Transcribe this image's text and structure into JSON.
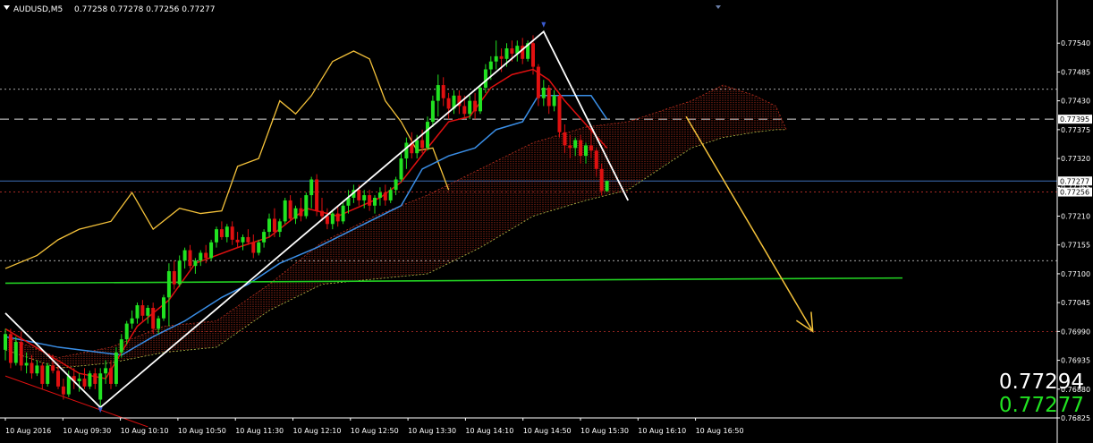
{
  "header": {
    "symbol_text": "AUDUSD,M5",
    "ohlc_text": "0.77258 0.77278 0.77256 0.77277"
  },
  "prices": {
    "bid": "0.77294",
    "ask": "0.77277"
  },
  "colors": {
    "background": "#000000",
    "bull": "#21e221",
    "bear": "#e01010",
    "tenkan": "#e01010",
    "kijun": "#3a8ee6",
    "chikou": "#f5c23a",
    "kumo": "#c0301f",
    "trendline": "#ffffff",
    "green_line": "#22d022",
    "forecast_arrow": "#f5c23a",
    "level_dotted": "#e0e0e0",
    "level_red_dotted": "#c0302a",
    "dashed_level": "#e0e0e0",
    "current_line": "#3d6fb8"
  },
  "chart_data": {
    "type": "candlestick",
    "symbol": "AUDUSD",
    "timeframe": "M5",
    "ylim": [
      0.76825,
      0.77595
    ],
    "yticks": [
      "0.77540",
      "0.77485",
      "0.77430",
      "0.77375",
      "0.77320",
      "0.77265",
      "0.77210",
      "0.77155",
      "0.77100",
      "0.77045",
      "0.76990",
      "0.76935",
      "0.76880",
      "0.76825"
    ],
    "xticks": [
      "10 Aug 2016",
      "10 Aug 09:30",
      "10 Aug 10:10",
      "10 Aug 10:50",
      "10 Aug 11:30",
      "10 Aug 12:10",
      "10 Aug 12:50",
      "10 Aug 13:30",
      "10 Aug 14:10",
      "10 Aug 14:50",
      "10 Aug 15:30",
      "10 Aug 16:10",
      "10 Aug 16:50"
    ],
    "price_tags": [
      {
        "value": 0.77395,
        "label": "0.77395"
      },
      {
        "value": 0.77277,
        "label": "0.77277"
      },
      {
        "value": 0.77256,
        "label": "0.77256"
      }
    ],
    "levels": {
      "dotted_white": [
        0.77452,
        0.77125
      ],
      "dotted_red": [
        0.77256,
        0.7699
      ],
      "dashed_white": 0.77395,
      "current": 0.77277
    },
    "green_line": [
      [
        0,
        0.77082
      ],
      [
        170,
        0.77092
      ]
    ],
    "trendlines": [
      {
        "points": [
          [
            0,
            0.77025
          ],
          [
            18,
            0.76845
          ],
          [
            102,
            0.77562
          ],
          [
            118,
            0.7724
          ]
        ]
      },
      {
        "points": [
          [
            0,
            0.76905
          ],
          [
            27,
            0.76808
          ]
        ]
      }
    ],
    "forecast_arrow": {
      "from": [
        129,
        0.774
      ],
      "to": [
        153,
        0.7699
      ]
    },
    "candles": [
      [
        0.76955,
        0.76995,
        0.76935,
        0.76985
      ],
      [
        0.76985,
        0.76995,
        0.7692,
        0.7693
      ],
      [
        0.7693,
        0.7698,
        0.76925,
        0.7697
      ],
      [
        0.7697,
        0.7699,
        0.76915,
        0.76925
      ],
      [
        0.76925,
        0.7695,
        0.7691,
        0.7693
      ],
      [
        0.7693,
        0.76945,
        0.769,
        0.7691
      ],
      [
        0.7691,
        0.76935,
        0.76905,
        0.76925
      ],
      [
        0.76925,
        0.7693,
        0.7688,
        0.7689
      ],
      [
        0.7689,
        0.7693,
        0.76885,
        0.76925
      ],
      [
        0.76925,
        0.76945,
        0.7691,
        0.76915
      ],
      [
        0.76915,
        0.7693,
        0.7688,
        0.76885
      ],
      [
        0.76885,
        0.769,
        0.7686,
        0.7687
      ],
      [
        0.7687,
        0.76915,
        0.76865,
        0.76905
      ],
      [
        0.76905,
        0.7692,
        0.7688,
        0.76895
      ],
      [
        0.76895,
        0.7691,
        0.76875,
        0.769
      ],
      [
        0.769,
        0.7692,
        0.7688,
        0.76885
      ],
      [
        0.76885,
        0.76915,
        0.7688,
        0.7691
      ],
      [
        0.7691,
        0.7692,
        0.7688,
        0.7689
      ],
      [
        0.7686,
        0.7692,
        0.76845,
        0.7691
      ],
      [
        0.7691,
        0.76935,
        0.7689,
        0.7692
      ],
      [
        0.7692,
        0.76935,
        0.7688,
        0.7689
      ],
      [
        0.7689,
        0.7696,
        0.76885,
        0.7695
      ],
      [
        0.7695,
        0.76985,
        0.7694,
        0.76975
      ],
      [
        0.76975,
        0.7701,
        0.76965,
        0.77005
      ],
      [
        0.77005,
        0.7703,
        0.76995,
        0.77015
      ],
      [
        0.77015,
        0.77045,
        0.77005,
        0.7704
      ],
      [
        0.7704,
        0.7705,
        0.7701,
        0.7702
      ],
      [
        0.7702,
        0.7704,
        0.77005,
        0.77035
      ],
      [
        0.77035,
        0.77045,
        0.76985,
        0.76995
      ],
      [
        0.76995,
        0.7702,
        0.76985,
        0.77015
      ],
      [
        0.77015,
        0.7706,
        0.7701,
        0.77055
      ],
      [
        0.77055,
        0.7712,
        0.77,
        0.77105
      ],
      [
        0.77105,
        0.77125,
        0.7707,
        0.7708
      ],
      [
        0.7708,
        0.77135,
        0.77075,
        0.77125
      ],
      [
        0.77125,
        0.7715,
        0.7711,
        0.77145
      ],
      [
        0.77145,
        0.77155,
        0.7711,
        0.77115
      ],
      [
        0.77115,
        0.7713,
        0.771,
        0.77125
      ],
      [
        0.77125,
        0.77145,
        0.77115,
        0.7714
      ],
      [
        0.7714,
        0.77155,
        0.7712,
        0.7713
      ],
      [
        0.7713,
        0.77165,
        0.77125,
        0.7716
      ],
      [
        0.7716,
        0.7719,
        0.7715,
        0.77185
      ],
      [
        0.77185,
        0.772,
        0.77165,
        0.7717
      ],
      [
        0.7717,
        0.77195,
        0.7716,
        0.7719
      ],
      [
        0.7719,
        0.772,
        0.77155,
        0.77165
      ],
      [
        0.77165,
        0.7718,
        0.7715,
        0.7716
      ],
      [
        0.7716,
        0.77175,
        0.77145,
        0.7717
      ],
      [
        0.7717,
        0.77185,
        0.77155,
        0.7716
      ],
      [
        0.7716,
        0.77175,
        0.7713,
        0.7714
      ],
      [
        0.7714,
        0.77165,
        0.77135,
        0.7716
      ],
      [
        0.7716,
        0.77185,
        0.7715,
        0.7718
      ],
      [
        0.7718,
        0.77215,
        0.7717,
        0.77205
      ],
      [
        0.77205,
        0.77225,
        0.7717,
        0.7718
      ],
      [
        0.7718,
        0.77205,
        0.7717,
        0.772
      ],
      [
        0.772,
        0.77245,
        0.77195,
        0.7724
      ],
      [
        0.7724,
        0.7725,
        0.772,
        0.77205
      ],
      [
        0.77205,
        0.7723,
        0.77195,
        0.77225
      ],
      [
        0.77225,
        0.77245,
        0.772,
        0.7721
      ],
      [
        0.7721,
        0.77255,
        0.77205,
        0.7725
      ],
      [
        0.7725,
        0.77285,
        0.77225,
        0.7728
      ],
      [
        0.7728,
        0.7729,
        0.7721,
        0.7722
      ],
      [
        0.7722,
        0.77245,
        0.772,
        0.7721
      ],
      [
        0.7721,
        0.77225,
        0.77185,
        0.77195
      ],
      [
        0.77195,
        0.7722,
        0.77185,
        0.77215
      ],
      [
        0.77215,
        0.7723,
        0.7719,
        0.772
      ],
      [
        0.772,
        0.77235,
        0.77195,
        0.7723
      ],
      [
        0.7723,
        0.7726,
        0.77215,
        0.77245
      ],
      [
        0.77245,
        0.7727,
        0.77235,
        0.7726
      ],
      [
        0.7726,
        0.7727,
        0.7723,
        0.7724
      ],
      [
        0.7724,
        0.7726,
        0.77225,
        0.7725
      ],
      [
        0.7725,
        0.7726,
        0.7722,
        0.7723
      ],
      [
        0.7723,
        0.7725,
        0.77215,
        0.77245
      ],
      [
        0.77245,
        0.77265,
        0.7723,
        0.77255
      ],
      [
        0.77255,
        0.7727,
        0.7723,
        0.7724
      ],
      [
        0.7724,
        0.77265,
        0.77235,
        0.7726
      ],
      [
        0.7726,
        0.77285,
        0.7725,
        0.7728
      ],
      [
        0.7728,
        0.7733,
        0.77275,
        0.7732
      ],
      [
        0.7732,
        0.7736,
        0.773,
        0.7735
      ],
      [
        0.7735,
        0.7737,
        0.7732,
        0.7733
      ],
      [
        0.7733,
        0.77365,
        0.7732,
        0.77355
      ],
      [
        0.77355,
        0.77375,
        0.7733,
        0.7734
      ],
      [
        0.7734,
        0.774,
        0.77335,
        0.7739
      ],
      [
        0.7739,
        0.7744,
        0.7738,
        0.7743
      ],
      [
        0.7743,
        0.7748,
        0.774,
        0.7746
      ],
      [
        0.7746,
        0.77475,
        0.7742,
        0.77435
      ],
      [
        0.77435,
        0.77445,
        0.77395,
        0.77415
      ],
      [
        0.77415,
        0.7745,
        0.77405,
        0.7744
      ],
      [
        0.7744,
        0.7745,
        0.77405,
        0.7742
      ],
      [
        0.7742,
        0.7744,
        0.77395,
        0.77405
      ],
      [
        0.77405,
        0.7744,
        0.77395,
        0.7743
      ],
      [
        0.7743,
        0.77445,
        0.77395,
        0.7741
      ],
      [
        0.7741,
        0.7746,
        0.77405,
        0.77455
      ],
      [
        0.77455,
        0.775,
        0.77445,
        0.7749
      ],
      [
        0.7749,
        0.77515,
        0.7747,
        0.77505
      ],
      [
        0.77505,
        0.77545,
        0.7749,
        0.77515
      ],
      [
        0.77515,
        0.7753,
        0.77485,
        0.7751
      ],
      [
        0.7751,
        0.7754,
        0.77495,
        0.7753
      ],
      [
        0.7753,
        0.77545,
        0.77505,
        0.7752
      ],
      [
        0.7752,
        0.77545,
        0.77505,
        0.77535
      ],
      [
        0.77535,
        0.7755,
        0.775,
        0.7751
      ],
      [
        0.7751,
        0.77545,
        0.77505,
        0.7754
      ],
      [
        0.7754,
        0.77555,
        0.7748,
        0.77495
      ],
      [
        0.77495,
        0.775,
        0.7742,
        0.77435
      ],
      [
        0.77435,
        0.7747,
        0.7742,
        0.77455
      ],
      [
        0.77455,
        0.7746,
        0.77405,
        0.7742
      ],
      [
        0.7742,
        0.7745,
        0.7741,
        0.7744
      ],
      [
        0.7744,
        0.77445,
        0.7736,
        0.7737
      ],
      [
        0.7737,
        0.77385,
        0.7733,
        0.77345
      ],
      [
        0.77345,
        0.77365,
        0.7732,
        0.7734
      ],
      [
        0.7734,
        0.7736,
        0.77325,
        0.77355
      ],
      [
        0.77355,
        0.77365,
        0.7731,
        0.77325
      ],
      [
        0.77325,
        0.7735,
        0.7731,
        0.77345
      ],
      [
        0.77345,
        0.7738,
        0.7732,
        0.77335
      ],
      [
        0.77335,
        0.7734,
        0.77285,
        0.773
      ],
      [
        0.773,
        0.7731,
        0.7725,
        0.77258
      ],
      [
        0.77258,
        0.77278,
        0.77256,
        0.77277
      ]
    ],
    "tenkan": [
      [
        0,
        0.76995
      ],
      [
        14,
        0.7691
      ],
      [
        19,
        0.769
      ],
      [
        25,
        0.77
      ],
      [
        31,
        0.7705
      ],
      [
        36,
        0.7712
      ],
      [
        44,
        0.7715
      ],
      [
        50,
        0.7717
      ],
      [
        57,
        0.77225
      ],
      [
        63,
        0.7721
      ],
      [
        71,
        0.77245
      ],
      [
        75,
        0.77275
      ],
      [
        80,
        0.7734
      ],
      [
        84,
        0.7739
      ],
      [
        88,
        0.774
      ],
      [
        92,
        0.77455
      ],
      [
        96,
        0.7748
      ],
      [
        100,
        0.7749
      ],
      [
        103,
        0.7747
      ],
      [
        106,
        0.7743
      ],
      [
        110,
        0.77385
      ],
      [
        114,
        0.7734
      ]
    ],
    "kijun": [
      [
        0,
        0.7698
      ],
      [
        10,
        0.7696
      ],
      [
        22,
        0.76945
      ],
      [
        28,
        0.7698
      ],
      [
        34,
        0.7701
      ],
      [
        41,
        0.77055
      ],
      [
        46,
        0.7708
      ],
      [
        52,
        0.7712
      ],
      [
        59,
        0.7715
      ],
      [
        65,
        0.7718
      ],
      [
        70,
        0.77205
      ],
      [
        75,
        0.7723
      ],
      [
        79,
        0.773
      ],
      [
        84,
        0.77325
      ],
      [
        89,
        0.7734
      ],
      [
        93,
        0.77375
      ],
      [
        98,
        0.7739
      ],
      [
        101,
        0.7744
      ],
      [
        106,
        0.7744
      ],
      [
        111,
        0.7744
      ],
      [
        114,
        0.77395
      ]
    ],
    "chikou": [
      [
        0,
        0.7711
      ],
      [
        6,
        0.77135
      ],
      [
        10,
        0.77165
      ],
      [
        14,
        0.77185
      ],
      [
        20,
        0.772
      ],
      [
        24,
        0.77255
      ],
      [
        28,
        0.77185
      ],
      [
        33,
        0.77225
      ],
      [
        37,
        0.77215
      ],
      [
        41,
        0.7722
      ],
      [
        44,
        0.77305
      ],
      [
        48,
        0.7732
      ],
      [
        52,
        0.7743
      ],
      [
        55,
        0.77405
      ],
      [
        58,
        0.7744
      ],
      [
        62,
        0.77505
      ],
      [
        66,
        0.77525
      ],
      [
        69,
        0.7751
      ],
      [
        72,
        0.7743
      ],
      [
        75,
        0.7739
      ],
      [
        78,
        0.77335
      ],
      [
        81,
        0.7734
      ],
      [
        84,
        0.7726
      ]
    ],
    "kumo_upper": [
      [
        0,
        0.7698
      ],
      [
        10,
        0.7694
      ],
      [
        20,
        0.7696
      ],
      [
        30,
        0.77
      ],
      [
        40,
        0.7701
      ],
      [
        50,
        0.7708
      ],
      [
        60,
        0.7716
      ],
      [
        70,
        0.7721
      ],
      [
        80,
        0.7725
      ],
      [
        90,
        0.773
      ],
      [
        100,
        0.7735
      ],
      [
        110,
        0.7738
      ],
      [
        118,
        0.7739
      ],
      [
        124,
        0.7741
      ],
      [
        130,
        0.7743
      ],
      [
        136,
        0.7746
      ],
      [
        142,
        0.7744
      ],
      [
        146,
        0.7742
      ],
      [
        148,
        0.77375
      ]
    ],
    "kumo_lower": [
      [
        0,
        0.76955
      ],
      [
        10,
        0.7692
      ],
      [
        20,
        0.7693
      ],
      [
        30,
        0.7695
      ],
      [
        40,
        0.7696
      ],
      [
        50,
        0.7703
      ],
      [
        60,
        0.7708
      ],
      [
        70,
        0.7709
      ],
      [
        80,
        0.771
      ],
      [
        90,
        0.7715
      ],
      [
        100,
        0.7721
      ],
      [
        110,
        0.7724
      ],
      [
        118,
        0.7726
      ],
      [
        124,
        0.773
      ],
      [
        130,
        0.7734
      ],
      [
        136,
        0.7736
      ],
      [
        142,
        0.7737
      ],
      [
        146,
        0.77375
      ],
      [
        148,
        0.77375
      ]
    ]
  }
}
